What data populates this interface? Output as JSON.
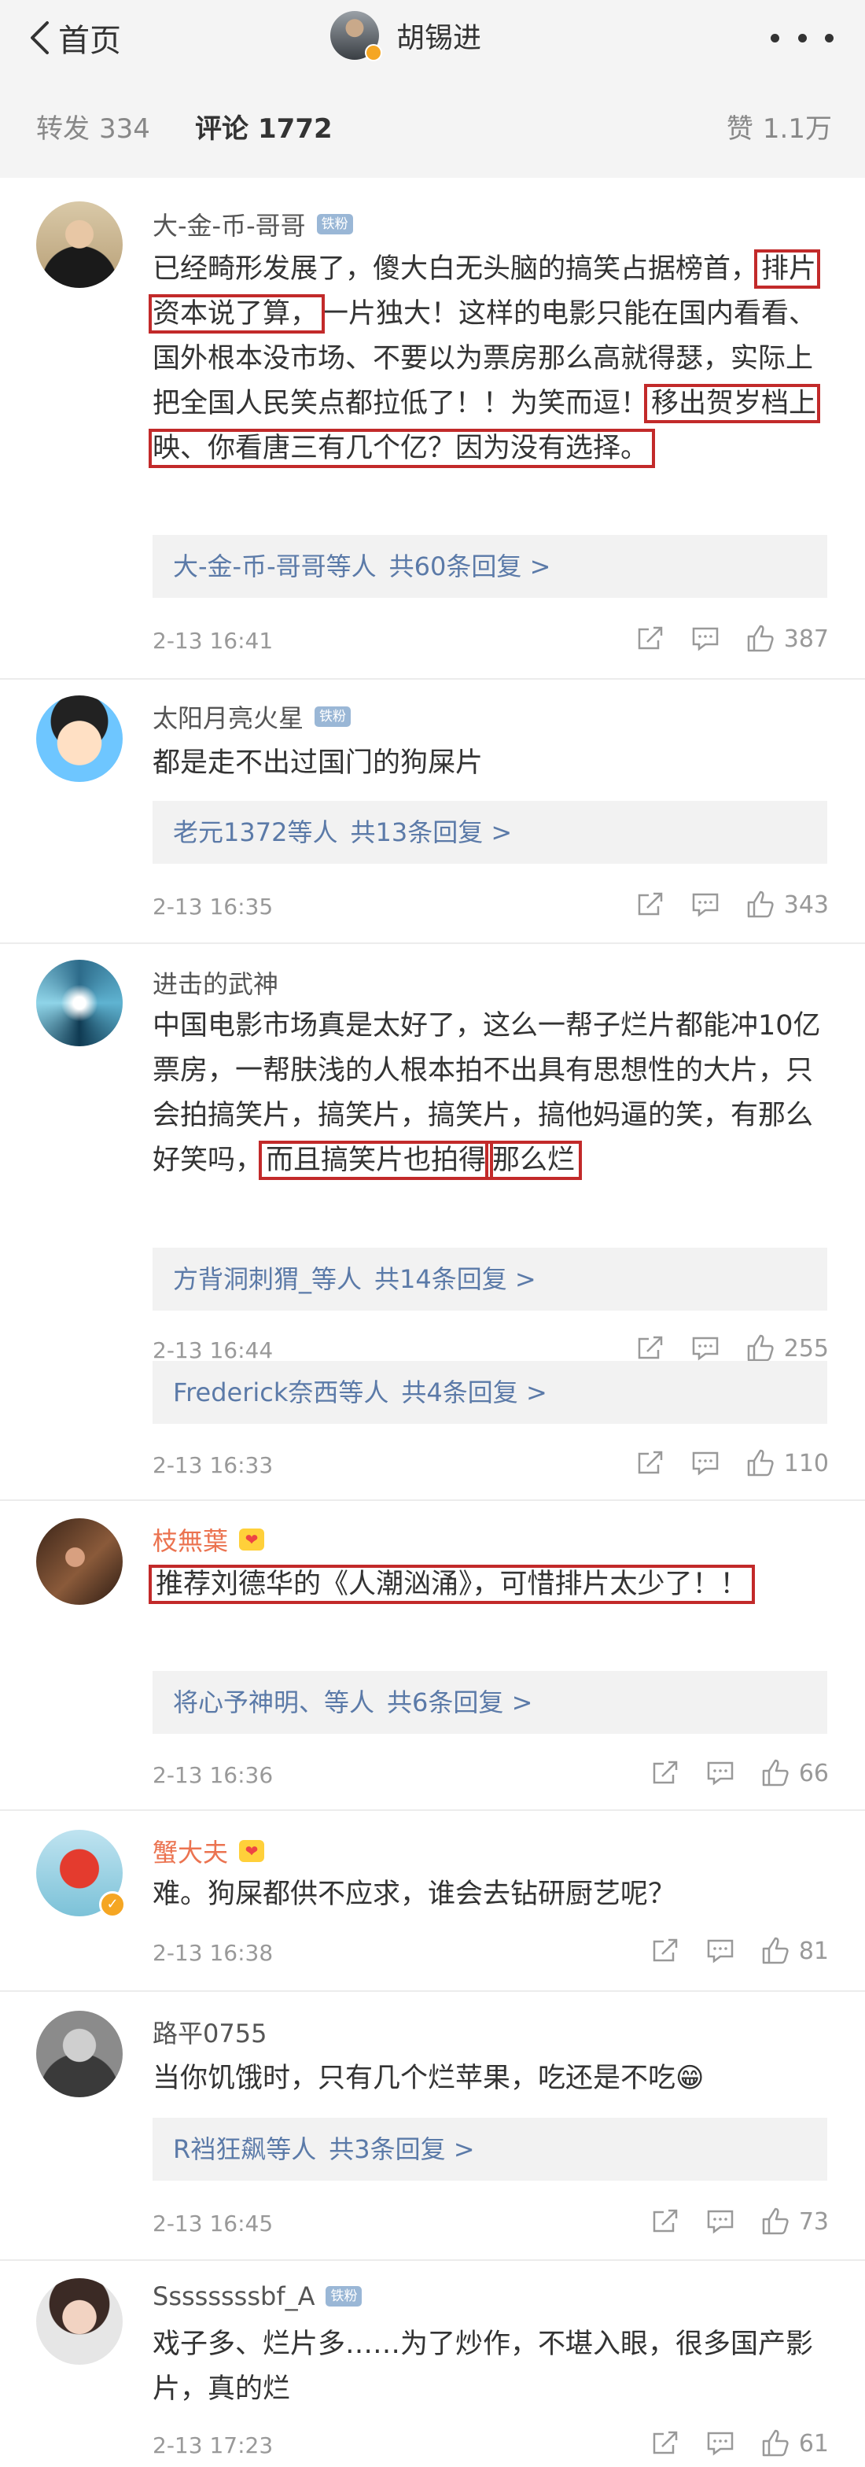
{
  "header": {
    "back_label": "首页",
    "title": "胡锡进"
  },
  "tabs": {
    "repost": {
      "label": "转发",
      "count": "334"
    },
    "comments": {
      "label": "评论",
      "count": "1772"
    },
    "likes": {
      "label": "赞",
      "count": "1.1万"
    }
  },
  "comments": [
    {
      "user": "大-金-币-哥哥",
      "badge": "铁粉",
      "segments": [
        "已经畸形发展了，傻大白无头脑的搞笑占据榜首，",
        "排片资本说了算，",
        "一片独大！这样的电影只能在国内看看、国外根本没市场、不要以为票房那么高就得瑟，实际上把全国人民笑点都拉低了！！为笑而逗！",
        "移出贺岁档上映、你看唐三有几个亿？因为没有选择。"
      ],
      "replies": {
        "who": "大-金-币-哥哥",
        "suffix": "等人",
        "count": "共60条回复 >"
      },
      "time": "2-13 16:41",
      "likes": "387"
    },
    {
      "user": "太阳月亮火星",
      "badge": "铁粉",
      "text": "都是走不出过国门的狗屎片",
      "replies": {
        "who": "老元1372",
        "suffix": "等人",
        "count": "共13条回复 >"
      },
      "time": "2-13 16:35",
      "likes": "343"
    },
    {
      "user": "进击的武神",
      "segments": [
        "中国电影市场真是太好了，这么一帮子烂片都能冲10亿票房，一帮肤浅的人根本拍不出具有思想性的大片，只会拍搞笑片，搞笑片，搞笑片，搞他妈逼的笑，有那么好笑吗，",
        "而且搞笑片也拍得",
        "那么烂"
      ],
      "replies": {
        "who": "方背洞刺猬_",
        "suffix": "等人",
        "count": "共14条回复 >"
      },
      "time": "2-13 16:44",
      "likes": "255"
    },
    {
      "replies": {
        "who": "Frederick奈西",
        "suffix": "等人",
        "count": "共4条回复 >"
      },
      "time": "2-13 16:33",
      "likes": "110"
    },
    {
      "user": "枝無葉",
      "badge": "❤",
      "text": "推荐刘德华的《人潮汹涌》，可惜排片太少了！！",
      "replies": {
        "who": "将心予神明、",
        "suffix": "等人",
        "count": "共6条回复 >"
      },
      "time": "2-13 16:36",
      "likes": "66"
    },
    {
      "user": "蟹大夫",
      "badge": "❤",
      "text": "难。狗屎都供不应求，谁会去钻研厨艺呢？",
      "time": "2-13 16:38",
      "likes": "81"
    },
    {
      "user": "路平0755",
      "text": "当你饥饿时，只有几个烂苹果，吃还是不吃😁",
      "replies": {
        "who": "R裆狂飙",
        "suffix": "等人",
        "count": "共3条回复 >"
      },
      "time": "2-13 16:45",
      "likes": "73"
    },
    {
      "user": "Ssssssssbf_A",
      "badge": "铁粉",
      "text": "戏子多、烂片多……为了炒作，不堪入眼，很多国产影片，真的烂",
      "time": "2-13 17:23",
      "likes": "61"
    }
  ],
  "colors": {
    "highlight_box": "#c22a2a",
    "reply_link": "#5b7aa8",
    "gold_username": "#eb7350",
    "header_bg": "#f4f4f4",
    "reply_bg": "#f2f2f2"
  },
  "icons": [
    "back-chevron-icon",
    "more-dots-icon",
    "repost-icon",
    "comment-icon",
    "like-icon"
  ]
}
